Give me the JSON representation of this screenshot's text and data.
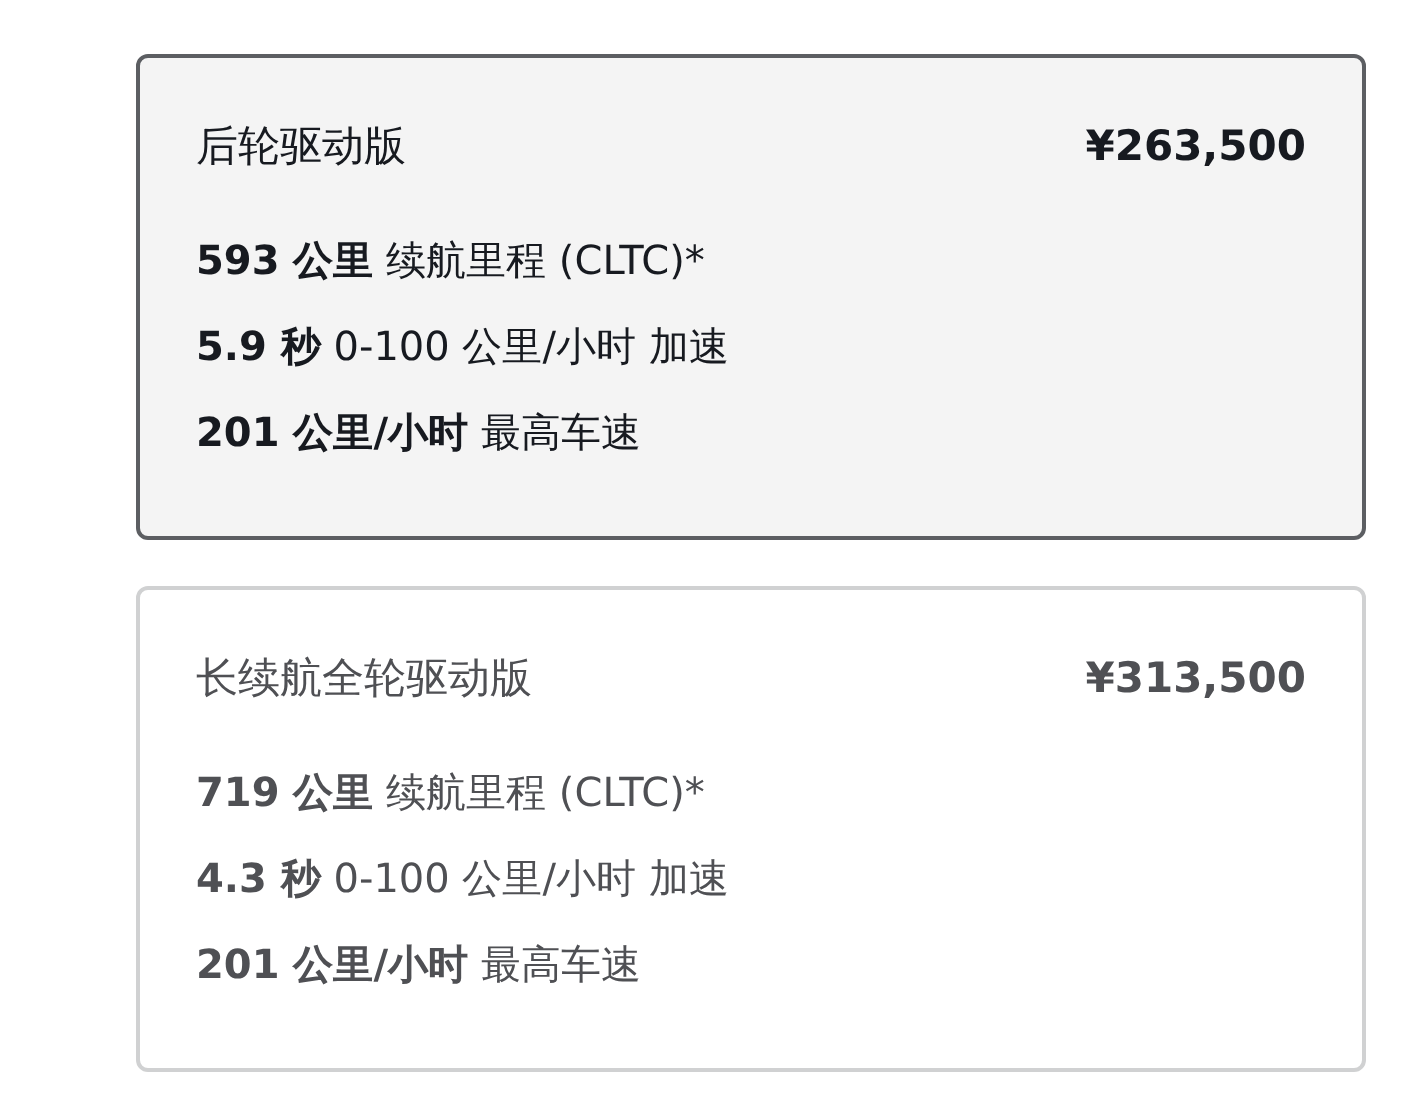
{
  "trims": [
    {
      "name": "后轮驱动版",
      "price": "¥263,500",
      "selected": true,
      "specs": [
        "**593 公里** 续航里程  (CLTC)*",
        "**5.9 秒** 0-100 公里/小时 加速",
        "**201 公里/小时** 最高车速"
      ]
    },
    {
      "name": "长续航全轮驱动版",
      "price": "¥313,500",
      "selected": false,
      "specs": [
        "**719 公里** 续航里程  (CLTC)*",
        "**4.3 秒** 0-100 公里/小时 加速",
        "**201 公里/小时** 最高车速"
      ]
    }
  ]
}
